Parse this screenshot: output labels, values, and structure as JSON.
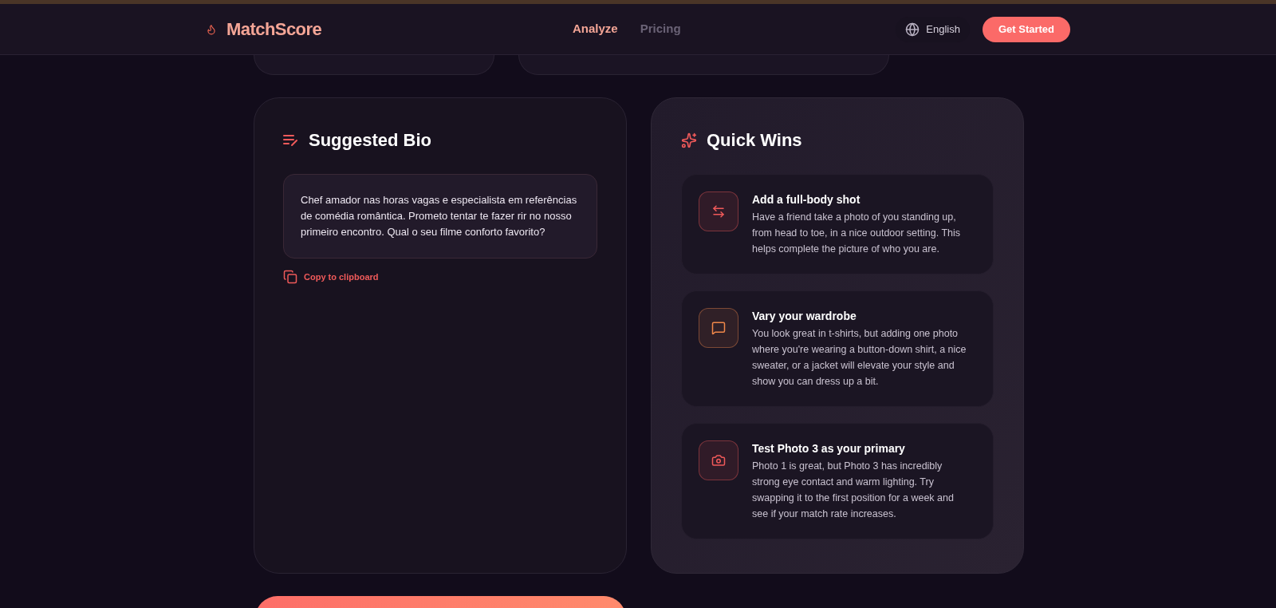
{
  "header": {
    "logo": "MatchScore",
    "nav": [
      {
        "label": "Analyze",
        "selected": true
      },
      {
        "label": "Pricing",
        "selected": false
      }
    ],
    "language": "English",
    "cta": "Get Started"
  },
  "bio": {
    "title": "Suggested Bio",
    "text": "Chef amador nas horas vagas e especialista em referências de comédia romântica. Prometo tentar te fazer rir no nosso primeiro encontro. Qual o seu filme conforto favorito?",
    "copy": "Copy to clipboard"
  },
  "quick_wins": {
    "title": "Quick Wins",
    "items": [
      {
        "kind": "swap",
        "color": "#f05a5a",
        "title": "Add a full-body shot",
        "text": "Have a friend take a photo of you standing up, from head to toe, in a nice outdoor setting. This helps complete the picture of who you are."
      },
      {
        "kind": "message",
        "color": "#f0874a",
        "title": "Vary your wardrobe",
        "text": "You look great in t-shirts, but adding one photo where you're wearing a button-down shirt, a nice sweater, or a jacket will elevate your style and show you can dress up a bit."
      },
      {
        "kind": "camera",
        "color": "#f05a5a",
        "title": "Test Photo 3 as your primary",
        "text": "Photo 1 is great, but Photo 3 has incredibly strong eye contact and warm lighting. Try swapping it to the first position for a week and see if your match rate increases."
      }
    ]
  }
}
